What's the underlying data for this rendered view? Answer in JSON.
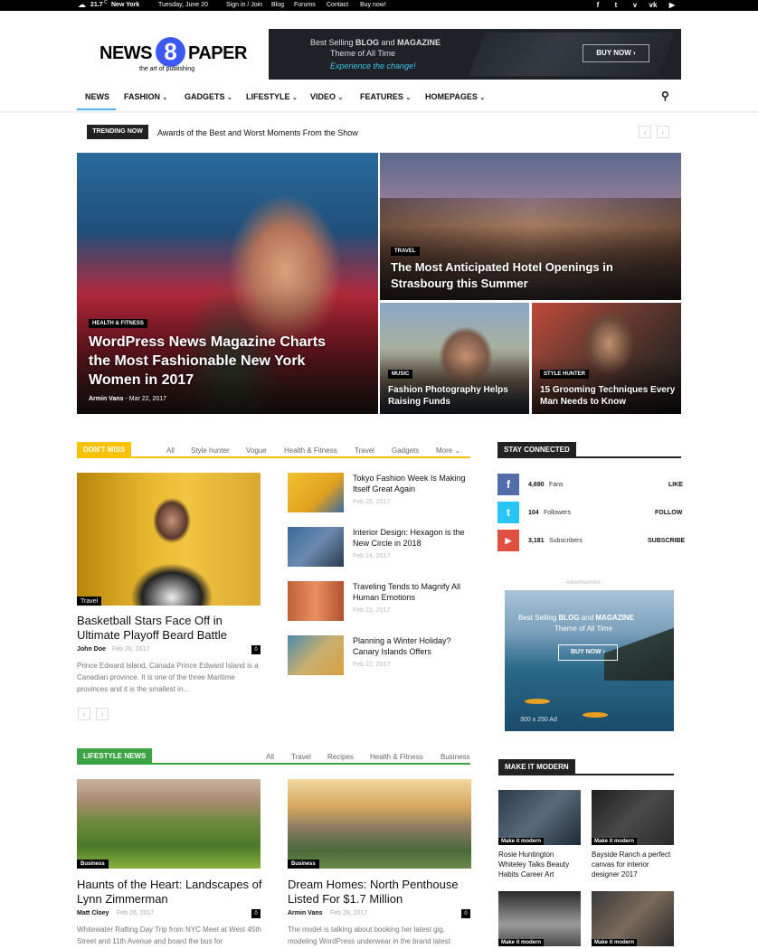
{
  "topbar": {
    "temp": "21.7",
    "temp_unit": "C",
    "city": "New York",
    "date": "Tuesday, June 20",
    "links": [
      "Sign in / Join",
      "Blog",
      "Forums",
      "Contact",
      "Buy now!"
    ],
    "social_icons": [
      "facebook-icon",
      "twitter-icon",
      "vimeo-icon",
      "vk-icon",
      "youtube-icon"
    ]
  },
  "logo": {
    "part1": "NEWS",
    "digit": "8",
    "part2": "PAPER",
    "tagline": "the art of publishing"
  },
  "banner": {
    "line1_prefix": "Best Selling ",
    "line1_bold": "BLOG",
    "line1_mid": " and ",
    "line1_bold2": "MAGAZINE",
    "line2": "Theme of All Time",
    "line3": "Experience the change!",
    "button": "BUY NOW"
  },
  "nav": {
    "items": [
      "NEWS",
      "FASHION",
      "GADGETS",
      "LIFESTYLE",
      "VIDEO",
      "FEATURES",
      "HOMEPAGES"
    ],
    "active": "NEWS"
  },
  "trending": {
    "label": "TRENDING NOW",
    "text": "Awards of the Best and Worst Moments From the Show"
  },
  "featured": {
    "main": {
      "category": "HEALTH & FITNESS",
      "title": "WordPress News Magazine Charts the Most Fashionable New York Women in 2017",
      "author": "Armin Vans",
      "date": "Mar 22, 2017"
    },
    "top_right": {
      "category": "TRAVEL",
      "title": "The Most Anticipated Hotel Openings in Strasbourg this Summer"
    },
    "bottom_left": {
      "category": "MUSIC",
      "title": "Fashion Photography Helps Raising Funds"
    },
    "bottom_right": {
      "category": "STYLE HUNTER",
      "title": "15 Grooming Techniques Every Man Needs to Know"
    }
  },
  "dont_miss": {
    "label": "DON'T MISS",
    "filters": [
      "All",
      "Style hunter",
      "Vogue",
      "Health & Fitness",
      "Travel",
      "Gadgets",
      "More"
    ],
    "main": {
      "category": "Travel",
      "title": "Basketball Stars Face Off in Ultimate Playoff Beard Battle",
      "author": "John Doe",
      "date": "Feb 26, 2017",
      "comments": "0",
      "excerpt": "Prince Edward Island, Canada Prince Edward Island is a Canadian province. It is one of the three Maritime provinces and it is the smallest in..."
    },
    "list": [
      {
        "title": "Tokyo Fashion Week Is Making Itself Great Again",
        "date": "Feb 25, 2017"
      },
      {
        "title": "Interior Design: Hexagon is the New Circle in 2018",
        "date": "Feb 24, 2017"
      },
      {
        "title": "Traveling Tends to Magnify All Human Emotions",
        "date": "Feb 23, 2017"
      },
      {
        "title": "Planning a Winter Holiday? Canary Islands Offers",
        "date": "Feb 22, 2017"
      }
    ]
  },
  "lifestyle": {
    "label": "LIFESTYLE NEWS",
    "filters": [
      "All",
      "Travel",
      "Recipes",
      "Health & Fitness",
      "Business"
    ],
    "articles": [
      {
        "category": "Business",
        "title": "Haunts of the Heart: Landscapes of Lynn Zimmerman",
        "author": "Matt Cloey",
        "date": "Feb 26, 2017",
        "comments": "0",
        "excerpt": "Whitewater Rafting Day Trip from NYC Meet at West 45th Street and 11th Avenue and board the bus for"
      },
      {
        "category": "Business",
        "title": "Dream Homes: North Penthouse Listed For $1.7 Million",
        "author": "Armin Vans",
        "date": "Feb 28, 2017",
        "comments": "0",
        "excerpt": "The model is talking about booking her latest gig, modeling WordPress underwear in the brand latest"
      }
    ]
  },
  "stay_connected": {
    "label": "STAY CONNECTED",
    "rows": [
      {
        "icon": "facebook-icon",
        "count": "4,690",
        "label": "Fans",
        "action": "LIKE",
        "color": "#516eab"
      },
      {
        "icon": "twitter-icon",
        "count": "104",
        "label": "Followers",
        "action": "FOLLOW",
        "color": "#29c5f6"
      },
      {
        "icon": "youtube-icon",
        "count": "3,181",
        "label": "Subscribers",
        "action": "SUBSCRIBE",
        "color": "#e14e42"
      }
    ]
  },
  "ad": {
    "caption": "- Advertisement -",
    "line1_prefix": "Best Selling ",
    "line1_bold": "BLOG",
    "line1_mid": " and ",
    "line1_bold2": "MAGAZINE",
    "line2": "Theme of All Time",
    "button": "BUY NOW",
    "size": "300 x 250 Ad"
  },
  "make_it_modern": {
    "label": "MAKE IT MODERN",
    "items": [
      {
        "category": "Make it modern",
        "title": "Rosie Huntington Whiteley Talks Beauty Habits Career Art"
      },
      {
        "category": "Make it modern",
        "title": "Bayside Ranch a perfect canvas for interior designer 2017"
      },
      {
        "category": "Make it modern",
        "title": ""
      },
      {
        "category": "Make it modern",
        "title": ""
      }
    ]
  },
  "colors": {
    "accent": "#4db2ec",
    "dont_miss": "#f9c100",
    "lifestyle": "#3ba546",
    "dark": "#222222"
  }
}
